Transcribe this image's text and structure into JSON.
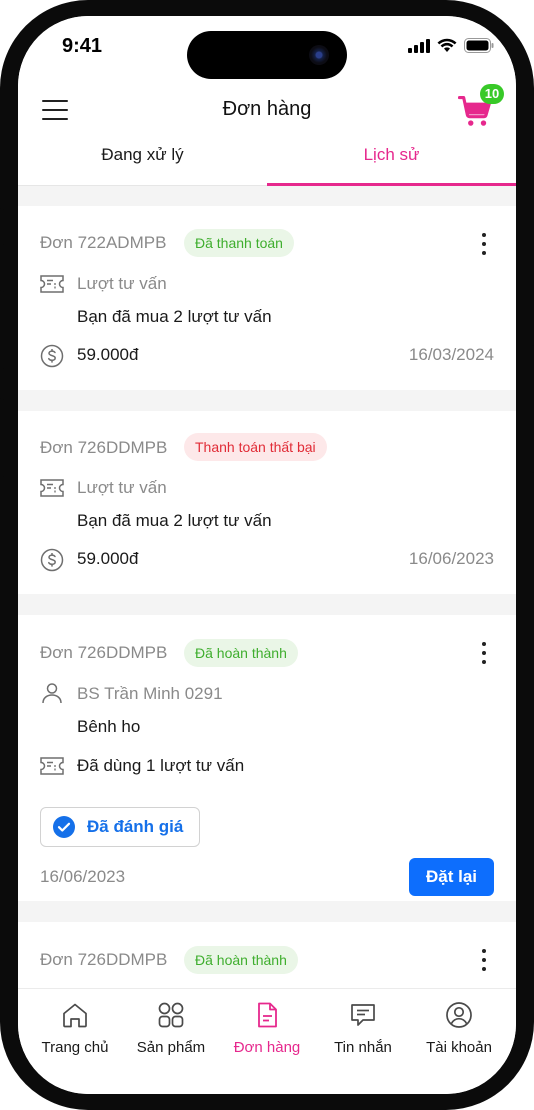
{
  "status_bar": {
    "time": "9:41"
  },
  "header": {
    "title": "Đơn hàng",
    "cart_count": "10"
  },
  "tabs": [
    {
      "label": "Đang xử lý",
      "active": false
    },
    {
      "label": "Lịch sử",
      "active": true
    }
  ],
  "orders": [
    {
      "id": "Đơn 722ADMPB",
      "status": "Đã thanh toán",
      "status_type": "success",
      "type_label": "Lượt tư vấn",
      "description": "Bạn đã mua 2 lượt tư vấn",
      "amount": "59.000đ",
      "date": "16/03/2024"
    },
    {
      "id": "Đơn 726DDMPB",
      "status": "Thanh toán thất bại",
      "status_type": "failed",
      "type_label": "Lượt tư vấn",
      "description": "Bạn đã mua 2 lượt tư vấn",
      "amount": "59.000đ",
      "date": "16/06/2023"
    },
    {
      "id": "Đơn 726DDMPB",
      "status": "Đã hoàn thành",
      "status_type": "success",
      "doctor": "BS Trần Minh 0291",
      "reason": "Bênh ho",
      "usage": "Đã dùng 1 lượt tư vấn",
      "rated_label": "Đã đánh giá",
      "date": "16/06/2023",
      "reorder_label": "Đặt lại"
    },
    {
      "id": "Đơn 726DDMPB",
      "status": "Đã hoàn thành",
      "status_type": "success"
    }
  ],
  "bottom_nav": [
    {
      "label": "Trang chủ",
      "icon": "home-icon",
      "active": false
    },
    {
      "label": "Sản phẩm",
      "icon": "grid-icon",
      "active": false
    },
    {
      "label": "Đơn hàng",
      "icon": "document-icon",
      "active": true
    },
    {
      "label": "Tin nhắn",
      "icon": "chat-icon",
      "active": false
    },
    {
      "label": "Tài khoản",
      "icon": "account-icon",
      "active": false
    }
  ],
  "colors": {
    "accent_pink": "#e6288d",
    "primary_blue": "#0d6efd",
    "success_green": "#3fae2e",
    "error_red": "#e12c37",
    "badge_green": "#38c928"
  }
}
